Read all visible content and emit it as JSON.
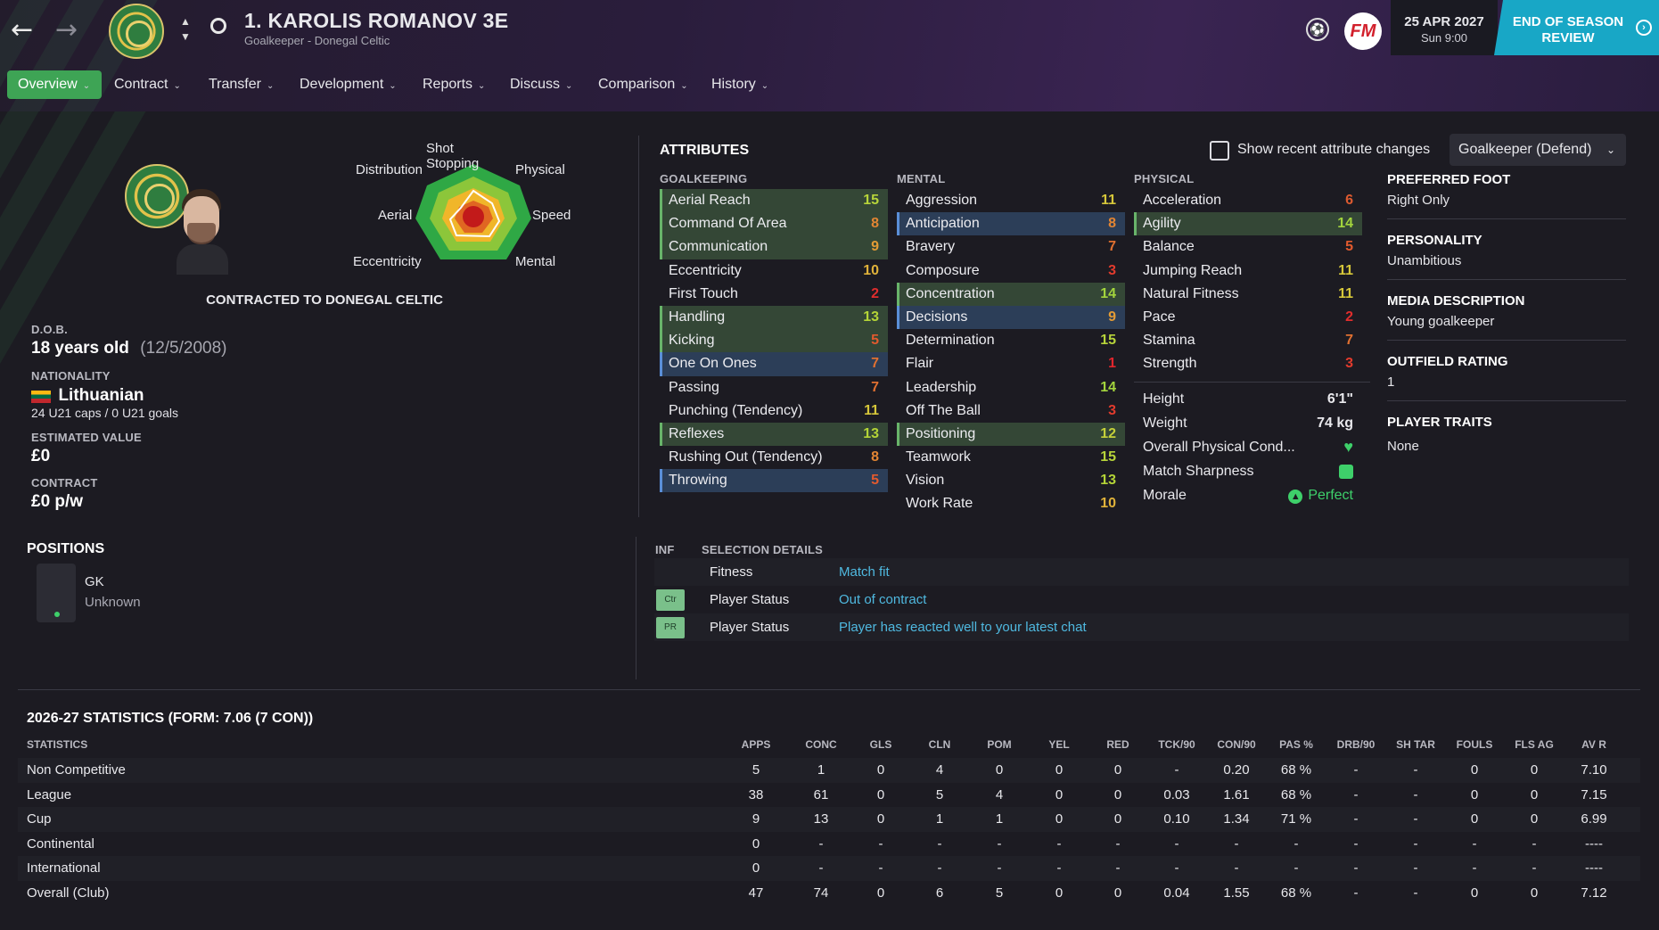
{
  "header": {
    "player_title": "1. KAROLIS ROMANOV 3E",
    "subtitle": "Goalkeeper - Donegal Celtic",
    "date": "25 APR 2027",
    "time": "Sun 9:00",
    "end_of_season": "END OF SEASON REVIEW",
    "fm_logo": "FM"
  },
  "nav": {
    "tabs": [
      "Overview",
      "Contract",
      "Transfer",
      "Development",
      "Reports",
      "Discuss",
      "Comparison",
      "History"
    ]
  },
  "profile": {
    "contracted": "CONTRACTED TO DONEGAL CELTIC",
    "dob_label": "D.O.B.",
    "age": "18 years old",
    "dob": "(12/5/2008)",
    "nationality_label": "NATIONALITY",
    "nationality": "Lithuanian",
    "caps": "24 U21 caps / 0 U21 goals",
    "value_label": "ESTIMATED VALUE",
    "value": "£0",
    "contract_label": "CONTRACT",
    "contract": "£0 p/w",
    "positions_title": "POSITIONS",
    "position": "GK",
    "position_rating": "Unknown"
  },
  "radar": {
    "labels": [
      "Shot Stopping",
      "Physical",
      "Speed",
      "Mental",
      "Eccentricity",
      "Aerial",
      "Distribution"
    ]
  },
  "attributes": {
    "title": "ATTRIBUTES",
    "show_changes": "Show recent attribute changes",
    "role": "Goalkeeper (Defend)",
    "goalkeeping_title": "GOALKEEPING",
    "mental_title": "MENTAL",
    "physical_title": "PHYSICAL",
    "goalkeeping": [
      {
        "name": "Aerial Reach",
        "value": "15",
        "hl": "g"
      },
      {
        "name": "Command Of Area",
        "value": "8",
        "hl": "g"
      },
      {
        "name": "Communication",
        "value": "9",
        "hl": "g"
      },
      {
        "name": "Eccentricity",
        "value": "10",
        "hl": ""
      },
      {
        "name": "First Touch",
        "value": "2",
        "hl": ""
      },
      {
        "name": "Handling",
        "value": "13",
        "hl": "g"
      },
      {
        "name": "Kicking",
        "value": "5",
        "hl": "g"
      },
      {
        "name": "One On Ones",
        "value": "7",
        "hl": "b"
      },
      {
        "name": "Passing",
        "value": "7",
        "hl": ""
      },
      {
        "name": "Punching (Tendency)",
        "value": "11",
        "hl": ""
      },
      {
        "name": "Reflexes",
        "value": "13",
        "hl": "g"
      },
      {
        "name": "Rushing Out (Tendency)",
        "value": "8",
        "hl": ""
      },
      {
        "name": "Throwing",
        "value": "5",
        "hl": "b"
      }
    ],
    "mental": [
      {
        "name": "Aggression",
        "value": "11",
        "hl": ""
      },
      {
        "name": "Anticipation",
        "value": "8",
        "hl": "b"
      },
      {
        "name": "Bravery",
        "value": "7",
        "hl": ""
      },
      {
        "name": "Composure",
        "value": "3",
        "hl": ""
      },
      {
        "name": "Concentration",
        "value": "14",
        "hl": "g"
      },
      {
        "name": "Decisions",
        "value": "9",
        "hl": "b"
      },
      {
        "name": "Determination",
        "value": "15",
        "hl": ""
      },
      {
        "name": "Flair",
        "value": "1",
        "hl": ""
      },
      {
        "name": "Leadership",
        "value": "14",
        "hl": ""
      },
      {
        "name": "Off The Ball",
        "value": "3",
        "hl": ""
      },
      {
        "name": "Positioning",
        "value": "12",
        "hl": "g"
      },
      {
        "name": "Teamwork",
        "value": "15",
        "hl": ""
      },
      {
        "name": "Vision",
        "value": "13",
        "hl": ""
      },
      {
        "name": "Work Rate",
        "value": "10",
        "hl": ""
      }
    ],
    "physical": [
      {
        "name": "Acceleration",
        "value": "6",
        "hl": ""
      },
      {
        "name": "Agility",
        "value": "14",
        "hl": "g"
      },
      {
        "name": "Balance",
        "value": "5",
        "hl": ""
      },
      {
        "name": "Jumping Reach",
        "value": "11",
        "hl": ""
      },
      {
        "name": "Natural Fitness",
        "value": "11",
        "hl": ""
      },
      {
        "name": "Pace",
        "value": "2",
        "hl": ""
      },
      {
        "name": "Stamina",
        "value": "7",
        "hl": ""
      },
      {
        "name": "Strength",
        "value": "3",
        "hl": ""
      }
    ],
    "height_label": "Height",
    "height": "6'1\"",
    "weight_label": "Weight",
    "weight": "74 kg",
    "condition_label": "Overall Physical Cond...",
    "sharpness_label": "Match Sharpness",
    "morale_label": "Morale",
    "morale": "Perfect"
  },
  "info": {
    "foot_label": "PREFERRED FOOT",
    "foot": "Right Only",
    "personality_label": "PERSONALITY",
    "personality": "Unambitious",
    "media_label": "MEDIA DESCRIPTION",
    "media": "Young goalkeeper",
    "outfield_label": "OUTFIELD RATING",
    "outfield": "1",
    "traits_label": "PLAYER TRAITS",
    "traits": "None"
  },
  "selection": {
    "inf_label": "INF",
    "title": "SELECTION DETAILS",
    "rows": [
      {
        "badge": "",
        "key": "Fitness",
        "value": "Match fit"
      },
      {
        "badge": "Ctr",
        "key": "Player Status",
        "value": "Out of contract"
      },
      {
        "badge": "PR",
        "key": "Player Status",
        "value": "Player has reacted well to your latest chat"
      }
    ]
  },
  "stats": {
    "title": "2026-27 STATISTICS (FORM: 7.06 (7 CON))",
    "headers": [
      "STATISTICS",
      "APPS",
      "CONC",
      "GLS",
      "CLN",
      "POM",
      "YEL",
      "RED",
      "TCK/90",
      "CON/90",
      "PAS %",
      "DRB/90",
      "SH TAR",
      "FOULS",
      "FLS AG",
      "AV R"
    ],
    "rows": [
      [
        "Non Competitive",
        "5",
        "1",
        "0",
        "4",
        "0",
        "0",
        "0",
        "-",
        "0.20",
        "68 %",
        "-",
        "-",
        "0",
        "0",
        "7.10"
      ],
      [
        "League",
        "38",
        "61",
        "0",
        "5",
        "4",
        "0",
        "0",
        "0.03",
        "1.61",
        "68 %",
        "-",
        "-",
        "0",
        "0",
        "7.15"
      ],
      [
        "Cup",
        "9",
        "13",
        "0",
        "1",
        "1",
        "0",
        "0",
        "0.10",
        "1.34",
        "71 %",
        "-",
        "-",
        "0",
        "0",
        "6.99"
      ],
      [
        "Continental",
        "0",
        "-",
        "-",
        "-",
        "-",
        "-",
        "-",
        "-",
        "-",
        "-",
        "-",
        "-",
        "-",
        "-",
        "----"
      ],
      [
        "International",
        "0",
        "-",
        "-",
        "-",
        "-",
        "-",
        "-",
        "-",
        "-",
        "-",
        "-",
        "-",
        "-",
        "-",
        "----"
      ],
      [
        "Overall (Club)",
        "47",
        "74",
        "0",
        "6",
        "5",
        "0",
        "0",
        "0.04",
        "1.55",
        "68 %",
        "-",
        "-",
        "0",
        "0",
        "7.12"
      ]
    ]
  },
  "colors": {
    "accent": "#3ea455",
    "highlight_blue": "#18a7c6",
    "link": "#4fb9e0"
  }
}
